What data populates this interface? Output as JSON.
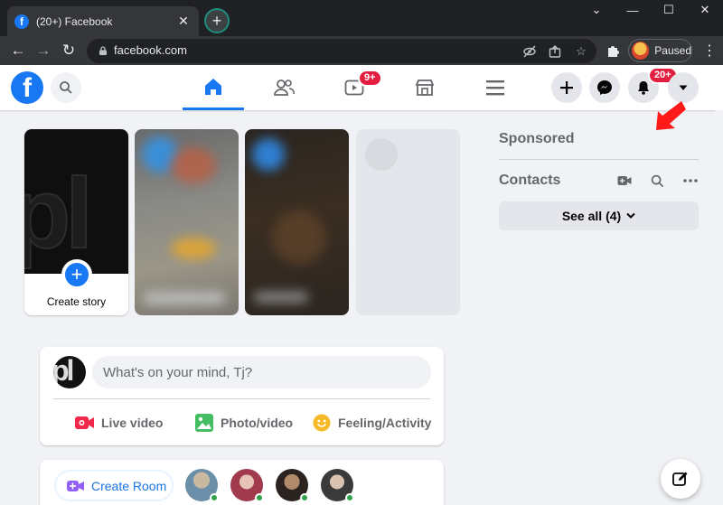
{
  "browser": {
    "tab_title": "(20+) Facebook",
    "favicon_letter": "f",
    "url": "facebook.com",
    "profile_label": "Paused",
    "icons": [
      "close-icon",
      "plus-icon",
      "minimize-icon",
      "maximize-icon",
      "back-icon",
      "forward-icon",
      "refresh-icon",
      "lock-icon",
      "eye-off-icon",
      "share-icon",
      "star-icon",
      "puzzle-icon",
      "kebab-menu-icon"
    ]
  },
  "fb_header": {
    "logo_letter": "f",
    "watch_badge": "9+",
    "notifications_badge": "20+",
    "accent_color": "#1877f2",
    "badge_color": "#e41e3f"
  },
  "stories": {
    "create_label": "Create story",
    "create_plus": "+"
  },
  "right_rail": {
    "sponsored": "Sponsored",
    "contacts": "Contacts",
    "see_all": "See all (4)"
  },
  "composer": {
    "placeholder": "What's on your mind, Tj?",
    "actions": [
      {
        "label": "Live video",
        "icon": "live-video-icon",
        "color": "#f02849"
      },
      {
        "label": "Photo/video",
        "icon": "photo-icon",
        "color": "#45bd62"
      },
      {
        "label": "Feeling/Activity",
        "icon": "feeling-icon",
        "color": "#f7b928"
      }
    ]
  },
  "rooms": {
    "create_room": "Create Room"
  }
}
